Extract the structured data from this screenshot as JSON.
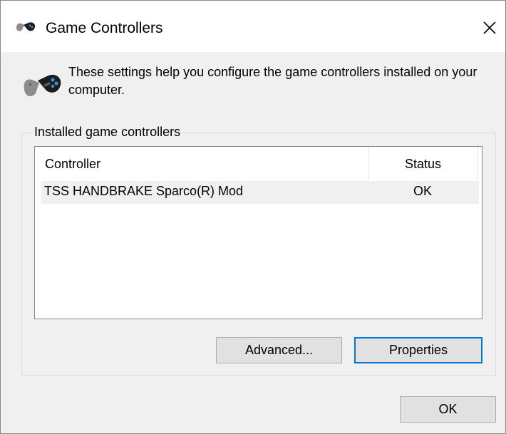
{
  "window": {
    "title": "Game Controllers",
    "title_icon": "gamepad-icon",
    "close_icon": "close-icon",
    "description": "These settings help you configure the game controllers installed on your computer."
  },
  "group": {
    "label": "Installed game controllers"
  },
  "table": {
    "columns": [
      "Controller",
      "Status"
    ],
    "rows": [
      {
        "controller": "TSS HANDBRAKE Sparco(R) Mod",
        "status": "OK"
      }
    ]
  },
  "buttons": {
    "advanced": "Advanced...",
    "properties": "Properties",
    "ok": "OK"
  },
  "colors": {
    "focus_border": "#0078d7",
    "window_bg": "#f0f0f0"
  }
}
